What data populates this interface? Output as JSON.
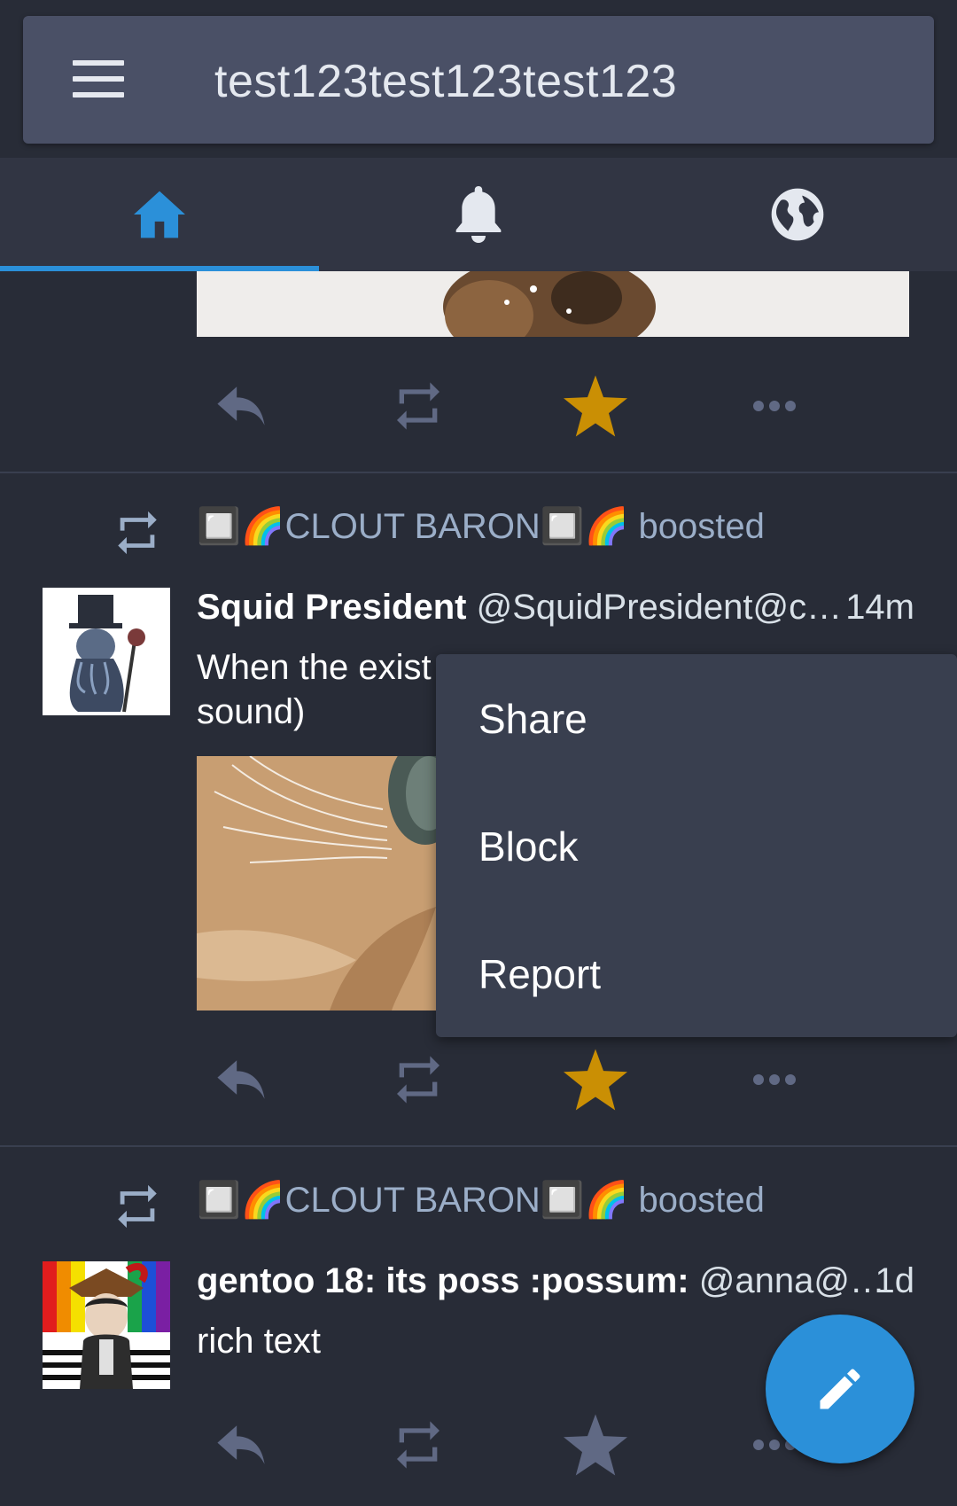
{
  "header": {
    "title": "test123test123test123",
    "menu_icon": "hamburger-menu-icon"
  },
  "tabs": [
    {
      "name": "home",
      "icon": "home-icon",
      "active": true
    },
    {
      "name": "notifications",
      "icon": "bell-icon",
      "active": false
    },
    {
      "name": "federated",
      "icon": "globe-icon",
      "active": false
    }
  ],
  "colors": {
    "accent": "#2b90d9",
    "favourited": "#ca8f04",
    "action_inactive": "#606984"
  },
  "statuses": [
    {
      "boosted_by": "🔲🌈CLOUT BARON🔲🌈",
      "boosted_suffix": "boosted",
      "display_name": "Squid President",
      "acct": "@SquidPresident@c…",
      "time": "14m",
      "content_line1": "When the exist",
      "content_line2": "sound)",
      "favourited": true
    },
    {
      "boosted_by": "🔲🌈CLOUT BARON🔲🌈",
      "boosted_suffix": "boosted",
      "display_name": "gentoo 18: its poss :possum:",
      "acct": "@anna@…",
      "time": "1d",
      "content": "rich text",
      "favourited": false
    }
  ],
  "menu": {
    "items": [
      "Share",
      "Block",
      "Report"
    ]
  },
  "fab": {
    "icon": "pencil-icon"
  }
}
